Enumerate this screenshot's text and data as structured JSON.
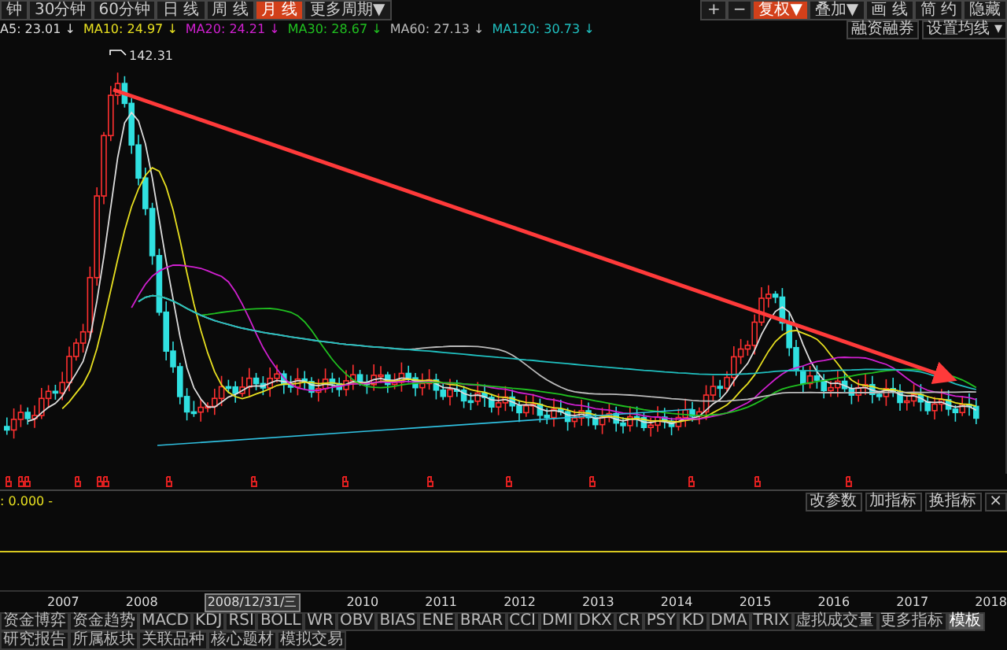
{
  "toolbar": {
    "periods": [
      {
        "label": "钟",
        "selected": false
      },
      {
        "label": "30分钟",
        "selected": false
      },
      {
        "label": "60分钟",
        "selected": false
      },
      {
        "label": "日 线",
        "selected": false
      },
      {
        "label": "周 线",
        "selected": false
      },
      {
        "label": "月 线",
        "selected": true
      },
      {
        "label": "更多周期▼",
        "selected": false
      }
    ],
    "tools": [
      {
        "label": "+",
        "selected": false
      },
      {
        "label": "−",
        "selected": false
      },
      {
        "label": "复权▼",
        "selected": true
      },
      {
        "label": "叠加▼",
        "selected": false
      },
      {
        "label": "画 线",
        "selected": false
      },
      {
        "label": "简 约",
        "selected": false
      },
      {
        "label": "隐藏",
        "selected": false
      }
    ]
  },
  "legend": [
    {
      "label": "A5: 23.01 ↓",
      "color": "#dddddd"
    },
    {
      "label": "MA10: 24.97 ↓",
      "color": "#e8e020"
    },
    {
      "label": "MA20: 24.21 ↓",
      "color": "#d020d0"
    },
    {
      "label": "MA30: 28.67 ↓",
      "color": "#20c020"
    },
    {
      "label": "MA60: 27.13 ↓",
      "color": "#bbbbbb"
    },
    {
      "label": "MA120: 30.73 ↓",
      "color": "#20c0c0"
    }
  ],
  "chart_buttons": [
    "融资融券",
    "设置均线 ▾"
  ],
  "chart": {
    "peak_label": "142.31"
  },
  "indicator": {
    "value": ": 0.000 -",
    "buttons": [
      "改参数",
      "加指标",
      "换指标",
      "×"
    ]
  },
  "axis": [
    {
      "label": "2007",
      "kind": "year"
    },
    {
      "label": "2008",
      "kind": "year"
    },
    {
      "label": "2008/12/31/三",
      "kind": "cursor"
    },
    {
      "label": "2010",
      "kind": "year"
    },
    {
      "label": "2011",
      "kind": "year"
    },
    {
      "label": "2012",
      "kind": "year"
    },
    {
      "label": "2013",
      "kind": "year"
    },
    {
      "label": "2014",
      "kind": "year"
    },
    {
      "label": "2015",
      "kind": "year"
    },
    {
      "label": "2016",
      "kind": "year"
    },
    {
      "label": "2017",
      "kind": "year"
    },
    {
      "label": "2018",
      "kind": "year"
    }
  ],
  "indicator_tabs": [
    {
      "label": "资金博弈",
      "selected": false
    },
    {
      "label": "资金趋势",
      "selected": false
    },
    {
      "label": "MACD",
      "selected": false
    },
    {
      "label": "KDJ",
      "selected": false
    },
    {
      "label": "RSI",
      "selected": false
    },
    {
      "label": "BOLL",
      "selected": false
    },
    {
      "label": "WR",
      "selected": false
    },
    {
      "label": "OBV",
      "selected": false
    },
    {
      "label": "BIAS",
      "selected": false
    },
    {
      "label": "ENE",
      "selected": false
    },
    {
      "label": "BRAR",
      "selected": false
    },
    {
      "label": "CCI",
      "selected": false
    },
    {
      "label": "DMI",
      "selected": false
    },
    {
      "label": "DKX",
      "selected": false
    },
    {
      "label": "CR",
      "selected": false
    },
    {
      "label": "PSY",
      "selected": false
    },
    {
      "label": "KD",
      "selected": false
    },
    {
      "label": "DMA",
      "selected": false
    },
    {
      "label": "TRIX",
      "selected": false
    },
    {
      "label": "虚拟成交量",
      "selected": false
    },
    {
      "label": "更多指标",
      "selected": false
    },
    {
      "label": "模板",
      "selected": true
    }
  ],
  "info_tabs": [
    "研究报告",
    "所属板块",
    "关联品种",
    "核心题材",
    "模拟交易"
  ]
}
